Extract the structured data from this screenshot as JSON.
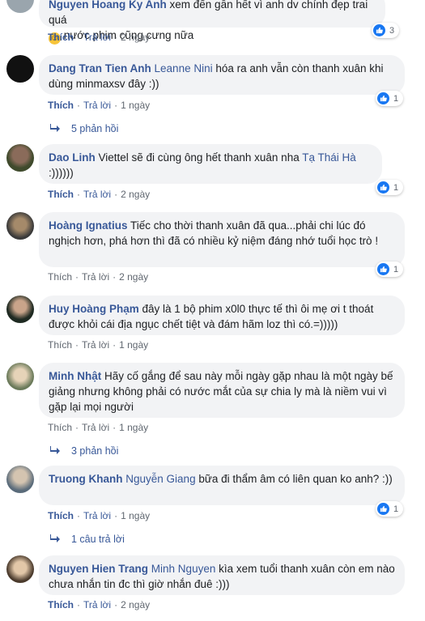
{
  "actions": {
    "like": "Thích",
    "reply": "Trả lời",
    "sep": "·"
  },
  "comments": [
    {
      "author": "Nguyen Hoang Ky Anh",
      "mention": "",
      "text_pre": "xem đến gần hết vì anh dv chính đẹp trai quá",
      "emoji": "☺",
      "text": "nước phim cũng cưng nữa",
      "time": "2 ngày",
      "reactions": "3"
    },
    {
      "author": "Dang Tran Tien Anh",
      "mention": "Leanne Nini",
      "text": "hóa ra anh vẫn còn thanh xuân khi dùng minmaxsv đây :))",
      "time": "1 ngày",
      "reactions": "1",
      "replies": "5 phản hồi"
    },
    {
      "author": "Dao Linh",
      "mention": "",
      "text": "Viettel sẽ đi cùng ông hết thanh xuân nha",
      "mention_end": "Tạ Thái Hà",
      "text2": ":))))))",
      "time": "2 ngày",
      "reactions": "1"
    },
    {
      "author": "Hoàng Ignatius",
      "mention": "",
      "text": "Tiếc cho thời thanh xuân đã qua...phải chi lúc đó nghịch hơn, phá hơn thì đã có nhiều kỷ niệm đáng nhớ tuổi học trò !",
      "time": "2 ngày",
      "reactions": "1"
    },
    {
      "author": "Huy Hoàng Phạm",
      "mention": "",
      "text": "đây là 1 bộ phim x0l0 thực tế thì ôi mẹ ơi t thoát được khỏi cái địa ngục chết tiệt và đám hãm loz thì có.=)))))",
      "time": "1 ngày"
    },
    {
      "author": "Minh Nhật",
      "mention": "",
      "text": "Hãy cố gắng để sau này mỗi ngày gặp nhau là một ngày bế giảng nhưng không phải có nước mắt của sự chia ly mà là niềm vui vì gặp lại mọi người",
      "time": "1 ngày",
      "replies": "3 phản hồi"
    },
    {
      "author": "Truong Khanh",
      "mention": "Nguyễn Giang",
      "text": "bữa đi thẩm âm có liên quan ko anh? :))",
      "time": "1 ngày",
      "reactions": "1",
      "replies": "1 câu trả lời"
    },
    {
      "author": "Nguyen Hien Trang",
      "mention": "Minh Nguyen",
      "text": "kìa xem tuổi thanh xuân còn em nào chưa nhắn tin đc thì giờ nhắn đuê :)))",
      "time": "2 ngày"
    }
  ],
  "colors": {
    "link": "#385898",
    "bubble": "#f2f3f5",
    "like": "#1877f2"
  },
  "icons": [
    "like-icon",
    "reply-arrow-icon",
    "avatar"
  ]
}
